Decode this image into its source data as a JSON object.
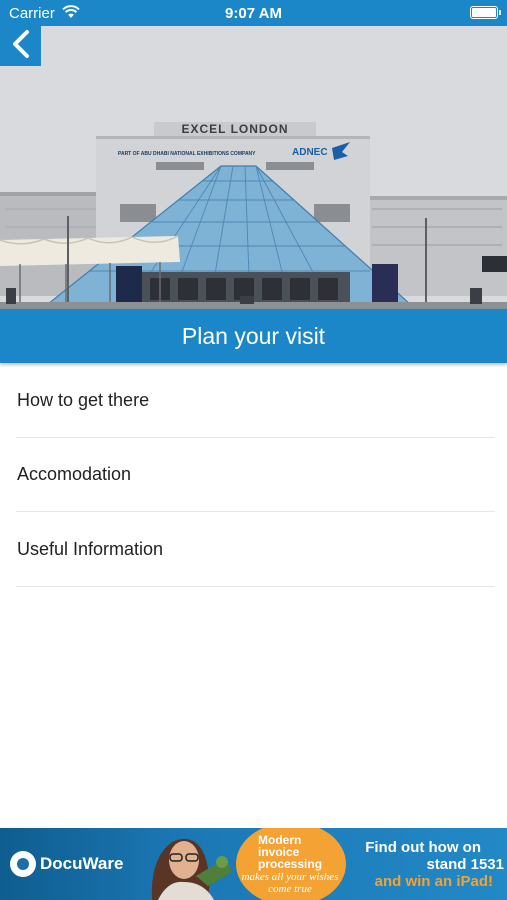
{
  "status_bar": {
    "carrier": "Carrier",
    "time": "9:07 AM"
  },
  "hero": {
    "building_sign": "EXCEL LONDON",
    "sign_subtext": "PART OF ABU DHABI NATIONAL EXHIBITIONS COMPANY",
    "brand": "ADNEC"
  },
  "section": {
    "title": "Plan your visit"
  },
  "menu": {
    "items": [
      {
        "label": "How to get there"
      },
      {
        "label": "Accomodation"
      },
      {
        "label": "Useful Information"
      }
    ]
  },
  "ad": {
    "logo_text": "DocuWare",
    "bubble_title": "Modern invoice processing",
    "bubble_sub": "makes all your wishes come true",
    "cta_line1": "Find out how on",
    "cta_line2": "stand 1531",
    "cta_line3": "and win an iPad!"
  },
  "colors": {
    "accent": "#1b87c8",
    "ad_orange": "#f3a233"
  }
}
